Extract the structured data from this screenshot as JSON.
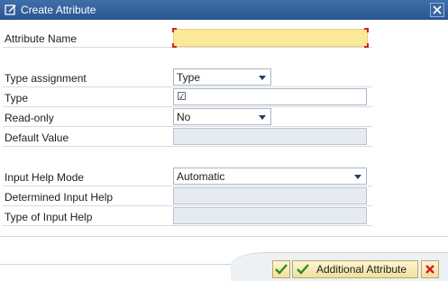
{
  "dialog": {
    "title": "Create Attribute"
  },
  "form": {
    "attribute_name": {
      "label": "Attribute Name",
      "value": ""
    },
    "type_assignment": {
      "label": "Type assignment",
      "value": "Type"
    },
    "type": {
      "label": "Type",
      "value": "☑"
    },
    "read_only": {
      "label": "Read-only",
      "value": "No"
    },
    "default_value": {
      "label": "Default Value",
      "value": ""
    },
    "input_help_mode": {
      "label": "Input Help Mode",
      "value": "Automatic"
    },
    "determined_input_help": {
      "label": "Determined Input Help",
      "value": ""
    },
    "type_of_input_help": {
      "label": "Type of Input Help",
      "value": ""
    }
  },
  "buttons": {
    "additional_attribute_label": "Additional Attribute"
  },
  "icons": {
    "title": "create-attribute-icon",
    "close": "close-icon",
    "ok": "checkmark-icon",
    "additional": "checkmark-icon",
    "cancel": "cancel-icon"
  },
  "colors": {
    "titlebar": "#2f5d99",
    "required_field": "#fbe99a",
    "disabled_field": "#e6ebef",
    "checkmark": "#2e8b2e",
    "cancel": "#d62020"
  }
}
